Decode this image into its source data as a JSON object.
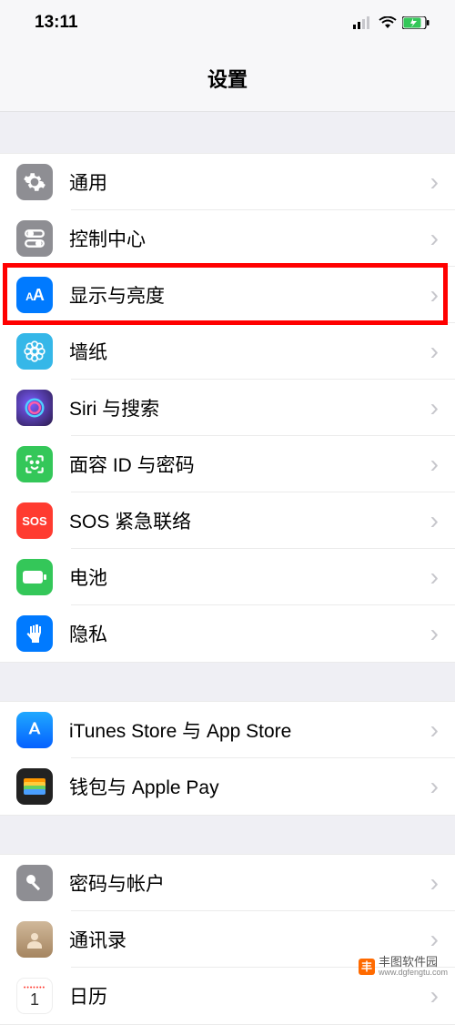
{
  "status": {
    "time": "13:11"
  },
  "header": {
    "title": "设置"
  },
  "sections": [
    {
      "rows": [
        {
          "id": "general",
          "label": "通用",
          "bg": "#8e8e93"
        },
        {
          "id": "control-center",
          "label": "控制中心",
          "bg": "#8e8e93"
        },
        {
          "id": "display-brightness",
          "label": "显示与亮度",
          "bg": "#007aff",
          "highlighted": true
        },
        {
          "id": "wallpaper",
          "label": "墙纸",
          "bg": "#54c3e7"
        },
        {
          "id": "siri-search",
          "label": "Siri 与搜索",
          "bg": "#212036"
        },
        {
          "id": "face-id",
          "label": "面容 ID 与密码",
          "bg": "#34c759"
        },
        {
          "id": "sos",
          "label": "SOS 紧急联络",
          "bg": "#ff3b30"
        },
        {
          "id": "battery",
          "label": "电池",
          "bg": "#34c759"
        },
        {
          "id": "privacy",
          "label": "隐私",
          "bg": "#007aff"
        }
      ]
    },
    {
      "rows": [
        {
          "id": "itunes-appstore",
          "label": "iTunes Store 与 App Store",
          "bg": "#1f8fff"
        },
        {
          "id": "wallet",
          "label": "钱包与 Apple Pay",
          "bg": "#222"
        }
      ]
    },
    {
      "rows": [
        {
          "id": "passwords",
          "label": "密码与帐户",
          "bg": "#8e8e93"
        },
        {
          "id": "contacts",
          "label": "通讯录",
          "bg": "#b08968"
        },
        {
          "id": "calendar",
          "label": "日历",
          "bg": "#fff"
        }
      ]
    }
  ],
  "watermark": {
    "name": "丰图软件园",
    "url": "www.dgfengtu.com"
  }
}
